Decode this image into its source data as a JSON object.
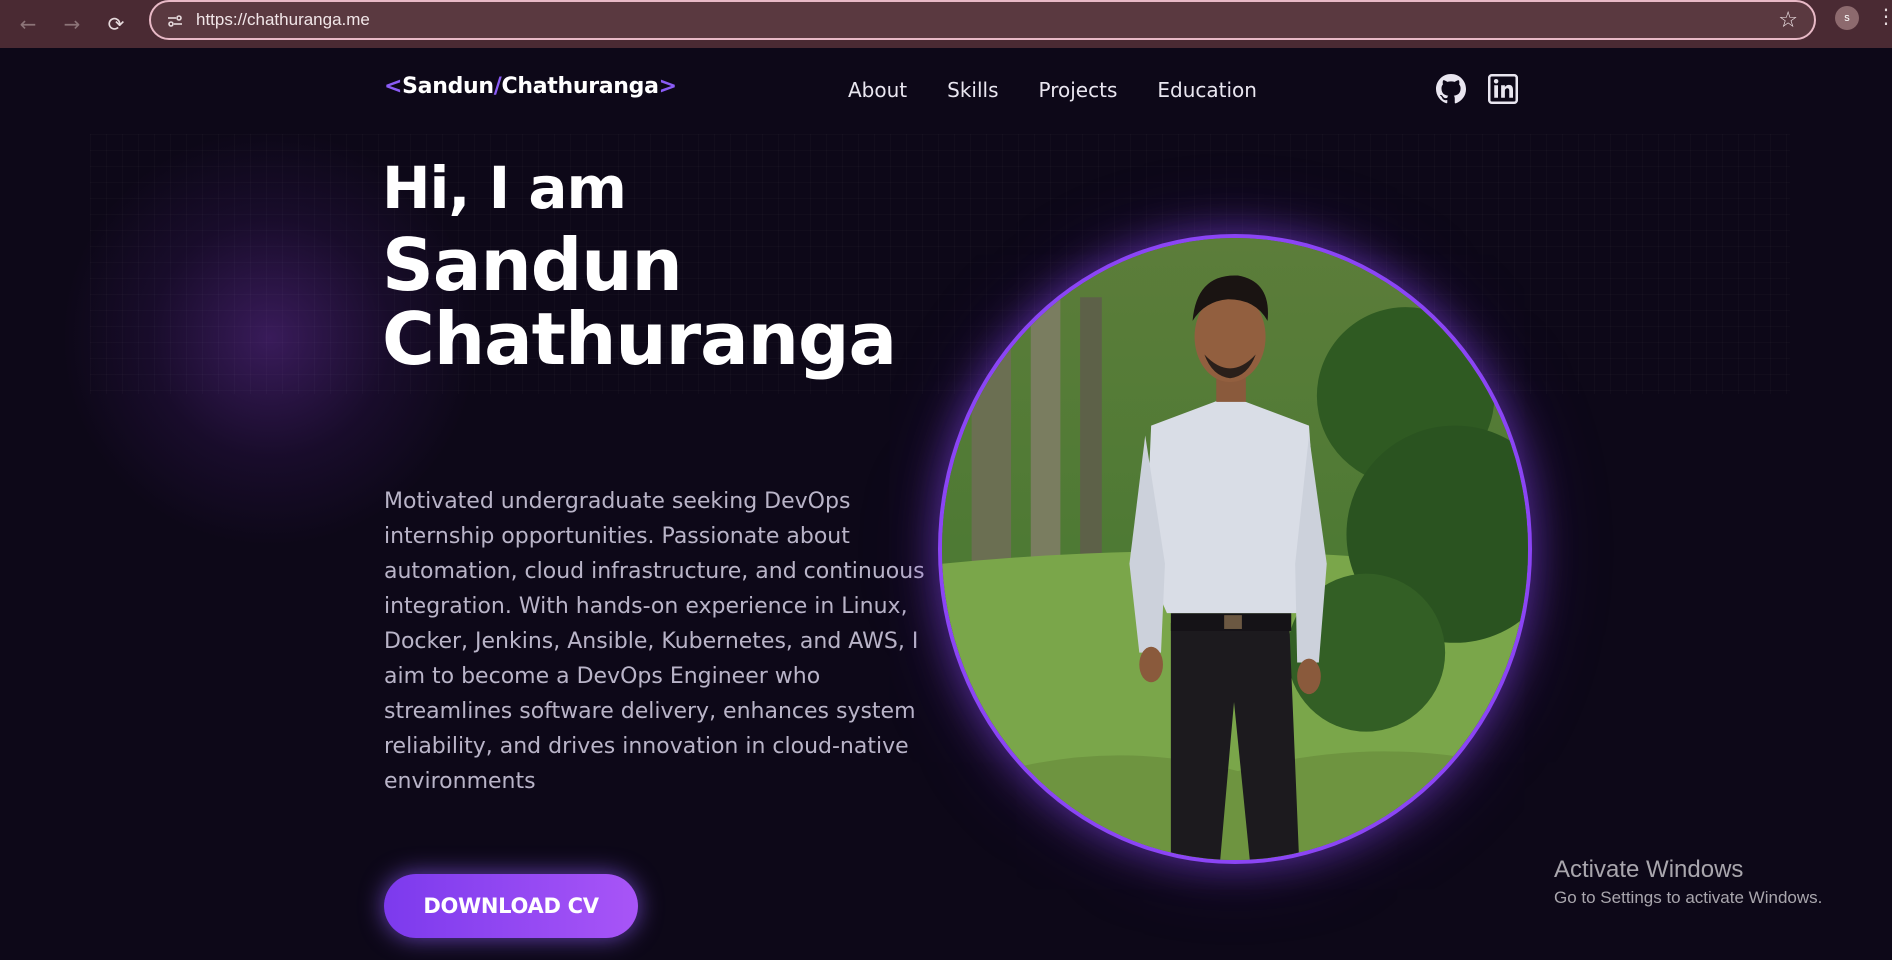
{
  "browser": {
    "url": "https://chathuranga.me",
    "back_icon": "←",
    "forward_icon": "→",
    "reload_icon": "⟳",
    "star_icon": "☆",
    "profile_initial": "s",
    "menu_icon": "⋮"
  },
  "header": {
    "logo_open": "<",
    "logo_first": "Sandun",
    "logo_sep": "/",
    "logo_last": "Chathuranga",
    "logo_close": ">",
    "menu": [
      "About",
      "Skills",
      "Projects",
      "Education"
    ],
    "social_icons": [
      "github-icon",
      "linkedin-icon"
    ]
  },
  "hero": {
    "greeting": "Hi, I am",
    "name": "Sandun Chathuranga",
    "bio": "Motivated undergraduate seeking DevOps internship opportunities. Passionate about automation, cloud infrastructure, and continuous integration. With hands-on experience in Linux, Docker, Jenkins, Ansible, Kubernetes, and AWS, I aim to become a DevOps Engineer who streamlines software delivery, enhances system reliability, and drives innovation in cloud-native environments",
    "cta_label": "DOWNLOAD CV"
  },
  "os_overlay": {
    "title": "Activate Windows",
    "subtitle": "Go to Settings to activate Windows."
  },
  "colors": {
    "accent": "#8b5cf6",
    "background": "#0d0818",
    "chrome": "#4a2a33"
  }
}
